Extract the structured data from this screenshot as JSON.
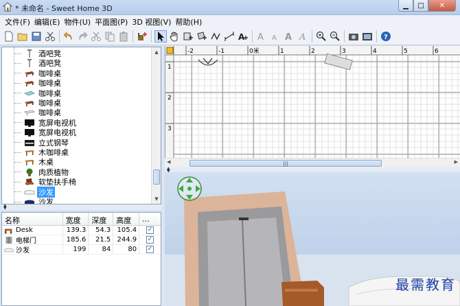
{
  "window": {
    "title": "* 未命名 - Sweet Home 3D",
    "controls": [
      "minimize",
      "maximize",
      "close"
    ]
  },
  "menu": [
    "文件(F)",
    "编辑(E)",
    "物件(U)",
    "平面图(P)",
    "3D 视图(V)",
    "帮助(H)"
  ],
  "toolbar": {
    "buttons": [
      "new-file",
      "open-folder",
      "save",
      "cut-tool",
      "undo",
      "redo",
      "cut",
      "copy",
      "paste",
      "add-furniture",
      "select-pointer",
      "pan-hand",
      "create-walls",
      "create-rooms",
      "create-dimensions",
      "add-text",
      "text-style-a",
      "text-style-b",
      "text-style-c",
      "text-style-d",
      "zoom-in",
      "zoom-out",
      "create-photo",
      "create-video",
      "help"
    ]
  },
  "catalog": {
    "items": [
      {
        "label": "酒吧凳",
        "icon": "bar-stool"
      },
      {
        "label": "酒吧凳",
        "icon": "bar-stool"
      },
      {
        "label": "咖啡桌",
        "icon": "coffee-table-wood"
      },
      {
        "label": "咖啡桌",
        "icon": "coffee-table-wood"
      },
      {
        "label": "咖啡桌",
        "icon": "coffee-table-glass"
      },
      {
        "label": "咖啡桌",
        "icon": "coffee-table-wood"
      },
      {
        "label": "咖啡桌",
        "icon": "coffee-table-white"
      },
      {
        "label": "宽屏电视机",
        "icon": "tv"
      },
      {
        "label": "宽屏电视机",
        "icon": "tv"
      },
      {
        "label": "立式钢琴",
        "icon": "piano"
      },
      {
        "label": "木咖啡桌",
        "icon": "wood-table"
      },
      {
        "label": "木桌",
        "icon": "wood-table"
      },
      {
        "label": "肉质植物",
        "icon": "plant"
      },
      {
        "label": "软垫扶手椅",
        "icon": "armchair"
      },
      {
        "label": "沙发",
        "icon": "sofa-white",
        "selected": true
      },
      {
        "label": "沙发",
        "icon": "sofa-navy"
      }
    ]
  },
  "furniture_table": {
    "columns": [
      "名称",
      "宽度",
      "深度",
      "高度",
      "..."
    ],
    "rows": [
      {
        "name": "Desk",
        "width": "139.3",
        "depth": "54.3",
        "height": "105.4",
        "visible": true,
        "icon": "desk"
      },
      {
        "name": "电梯门",
        "width": "185.6",
        "depth": "21.5",
        "height": "244.9",
        "visible": true,
        "icon": "elevator-door"
      },
      {
        "name": "沙发",
        "width": "199",
        "depth": "84",
        "height": "80",
        "visible": true,
        "icon": "sofa"
      }
    ]
  },
  "plan": {
    "ruler_x": [
      "-2",
      "-1",
      "0米",
      "1",
      "2",
      "3",
      "4",
      "5",
      "6"
    ],
    "ruler_y": [
      "1",
      "2",
      "3"
    ]
  },
  "watermark": "最需教育"
}
